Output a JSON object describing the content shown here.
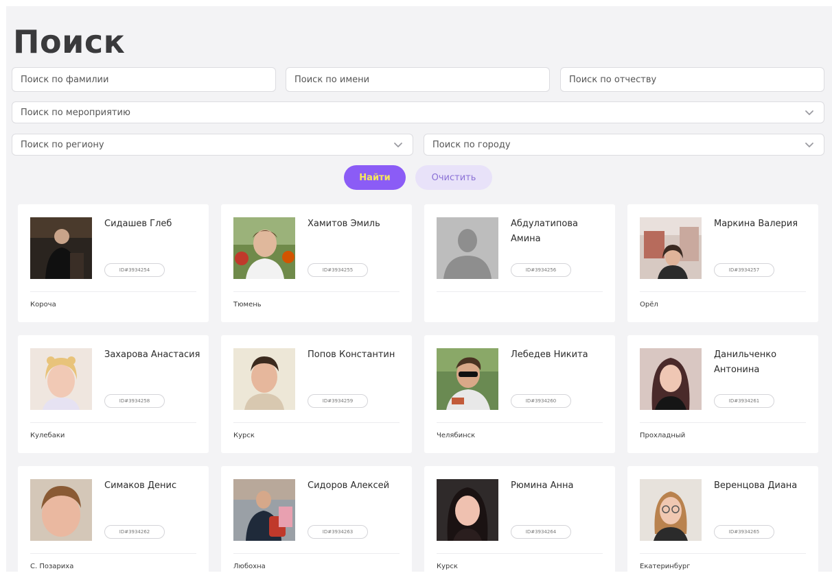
{
  "page": {
    "title": "Поиск"
  },
  "search": {
    "surname_placeholder": "Поиск по фамилии",
    "name_placeholder": "Поиск по имени",
    "patronymic_placeholder": "Поиск по отчеству",
    "event_placeholder": "Поиск по мероприятию",
    "region_placeholder": "Поиск по региону",
    "city_placeholder": "Поиск по городу",
    "find_label": "Найти",
    "clear_label": "Очистить"
  },
  "colors": {
    "accent": "#8b5cf6",
    "accent_text": "#f5e85c",
    "clear_bg": "#e8e2f9",
    "page_bg": "#f3f3f5"
  },
  "people": [
    {
      "name": "Сидашев Глеб",
      "id": "ID#3934254",
      "city": "Короча",
      "photo": "photo-dark-portrait"
    },
    {
      "name": "Хамитов Эмиль",
      "id": "ID#3934255",
      "city": "Тюмень",
      "photo": "photo-boy-outdoors"
    },
    {
      "name": "Абдулатипова Амина",
      "id": "ID#3934256",
      "city": "",
      "photo": "avatar-placeholder"
    },
    {
      "name": "Маркина Валерия",
      "id": "ID#3934257",
      "city": "Орёл",
      "photo": "photo-girl-carousel"
    },
    {
      "name": "Захарова Анастасия",
      "id": "ID#3934258",
      "city": "Кулебаки",
      "photo": "photo-girl-blonde"
    },
    {
      "name": "Попов Константин",
      "id": "ID#3934259",
      "city": "Курск",
      "photo": "photo-boy-id"
    },
    {
      "name": "Лебедев Никита",
      "id": "ID#3934260",
      "city": "Челябинск",
      "photo": "photo-boy-sunglasses"
    },
    {
      "name": "Данильченко Антонина",
      "id": "ID#3934261",
      "city": "Прохладный",
      "photo": "photo-girl-dark-hair"
    },
    {
      "name": "Симаков Денис",
      "id": "ID#3934262",
      "city": "С. Позариха",
      "photo": "photo-boy-closeup"
    },
    {
      "name": "Сидоров Алексей",
      "id": "ID#3934263",
      "city": "Любохна",
      "photo": "photo-man-suit"
    },
    {
      "name": "Рюмина Анна",
      "id": "ID#3934264",
      "city": "Курск",
      "photo": "photo-girl-dark"
    },
    {
      "name": "Веренцова Диана",
      "id": "ID#3934265",
      "city": "Екатеринбург",
      "photo": "photo-girl-glasses"
    }
  ]
}
